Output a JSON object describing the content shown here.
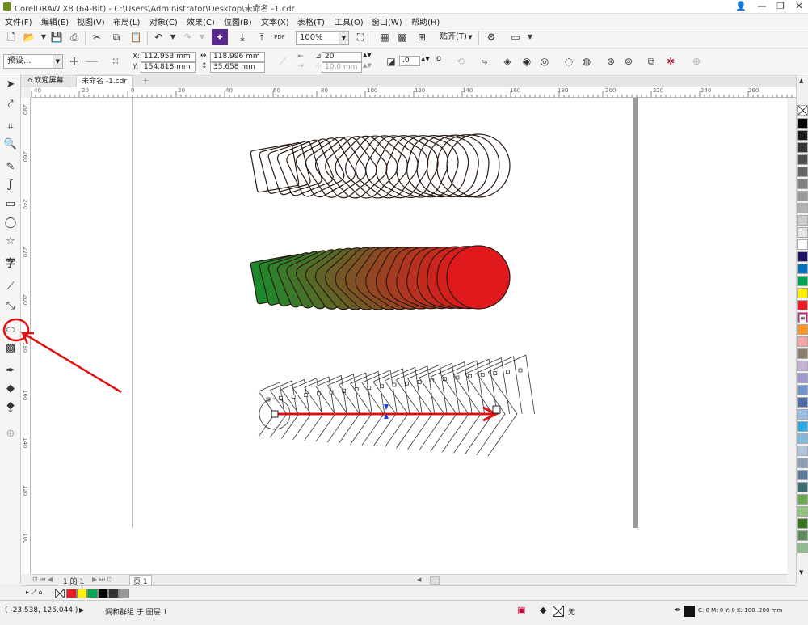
{
  "window": {
    "title": "CorelDRAW X8 (64-Bit) - C:\\Users\\Administrator\\Desktop\\未命名 -1.cdr",
    "controls": [
      "👤",
      "—",
      "❐",
      "✕"
    ]
  },
  "menu": [
    "文件(F)",
    "编辑(E)",
    "视图(V)",
    "布局(L)",
    "对象(C)",
    "效果(C)",
    "位图(B)",
    "文本(X)",
    "表格(T)",
    "工具(O)",
    "窗口(W)",
    "帮助(H)"
  ],
  "standard_toolbar": {
    "zoom": "100%",
    "snap": "贴齐(T)",
    "publish": "PDF"
  },
  "property_bar": {
    "preset": "预设...",
    "x_label": "X:",
    "x": "112.953 mm",
    "y_label": "Y:",
    "y": "154.818 mm",
    "w": "118.996 mm",
    "h": "35.658 mm",
    "steps": "20",
    "spacing": "10.0 mm",
    "rotation": ".0",
    "rotation_unit": "o"
  },
  "tabs": {
    "welcome": "欢迎屏幕",
    "doc": "未命名 -1.cdr"
  },
  "ruler": {
    "h_ticks": [
      "40",
      "20",
      "0",
      "20",
      "40",
      "60",
      "80",
      "100",
      "120",
      "140",
      "160",
      "180",
      "200",
      "220",
      "240",
      "260"
    ],
    "v_ticks": [
      "280",
      "260",
      "240",
      "220",
      "200",
      "180",
      "160",
      "140",
      "120",
      "100"
    ]
  },
  "page_nav": {
    "page_count": "1 的 1",
    "page_tab": "页 1"
  },
  "palette_colors": [
    "#000000",
    "#1a1a1a",
    "#333333",
    "#4d4d4d",
    "#666666",
    "#808080",
    "#999999",
    "#b3b3b3",
    "#cccccc",
    "#e6e6e6",
    "#ffffff",
    "#1b1464",
    "#0071bc",
    "#00a651",
    "#fff200",
    "#ed1c24",
    "#ec008c",
    "#f7941d",
    "#f4a6a6",
    "#8b7d6b",
    "#c7b2d6",
    "#9e9ad1",
    "#6f92c8",
    "#4f6ba6",
    "#9bc2e6",
    "#29abe2",
    "#7fb9e0",
    "#b0c4de",
    "#8c9fb5",
    "#5b7a99",
    "#3c6e71",
    "#6aa84f",
    "#93c47d",
    "#38761d",
    "#5c8a5c",
    "#8fbc8f"
  ],
  "doc_palette_colors": [
    "#ed1c24",
    "#fff200",
    "#00a651",
    "#000000",
    "#333333",
    "#999999"
  ],
  "status": {
    "cursor": "( -23.538, 125.044 )",
    "selection": "调和群组 于 图层 1",
    "fill_none": "无",
    "outline": "C: 0 M: 0 Y: 0 K: 100 .200 mm"
  },
  "colors": {
    "accent_red": "#e0191c",
    "highlight": "#e01010"
  }
}
